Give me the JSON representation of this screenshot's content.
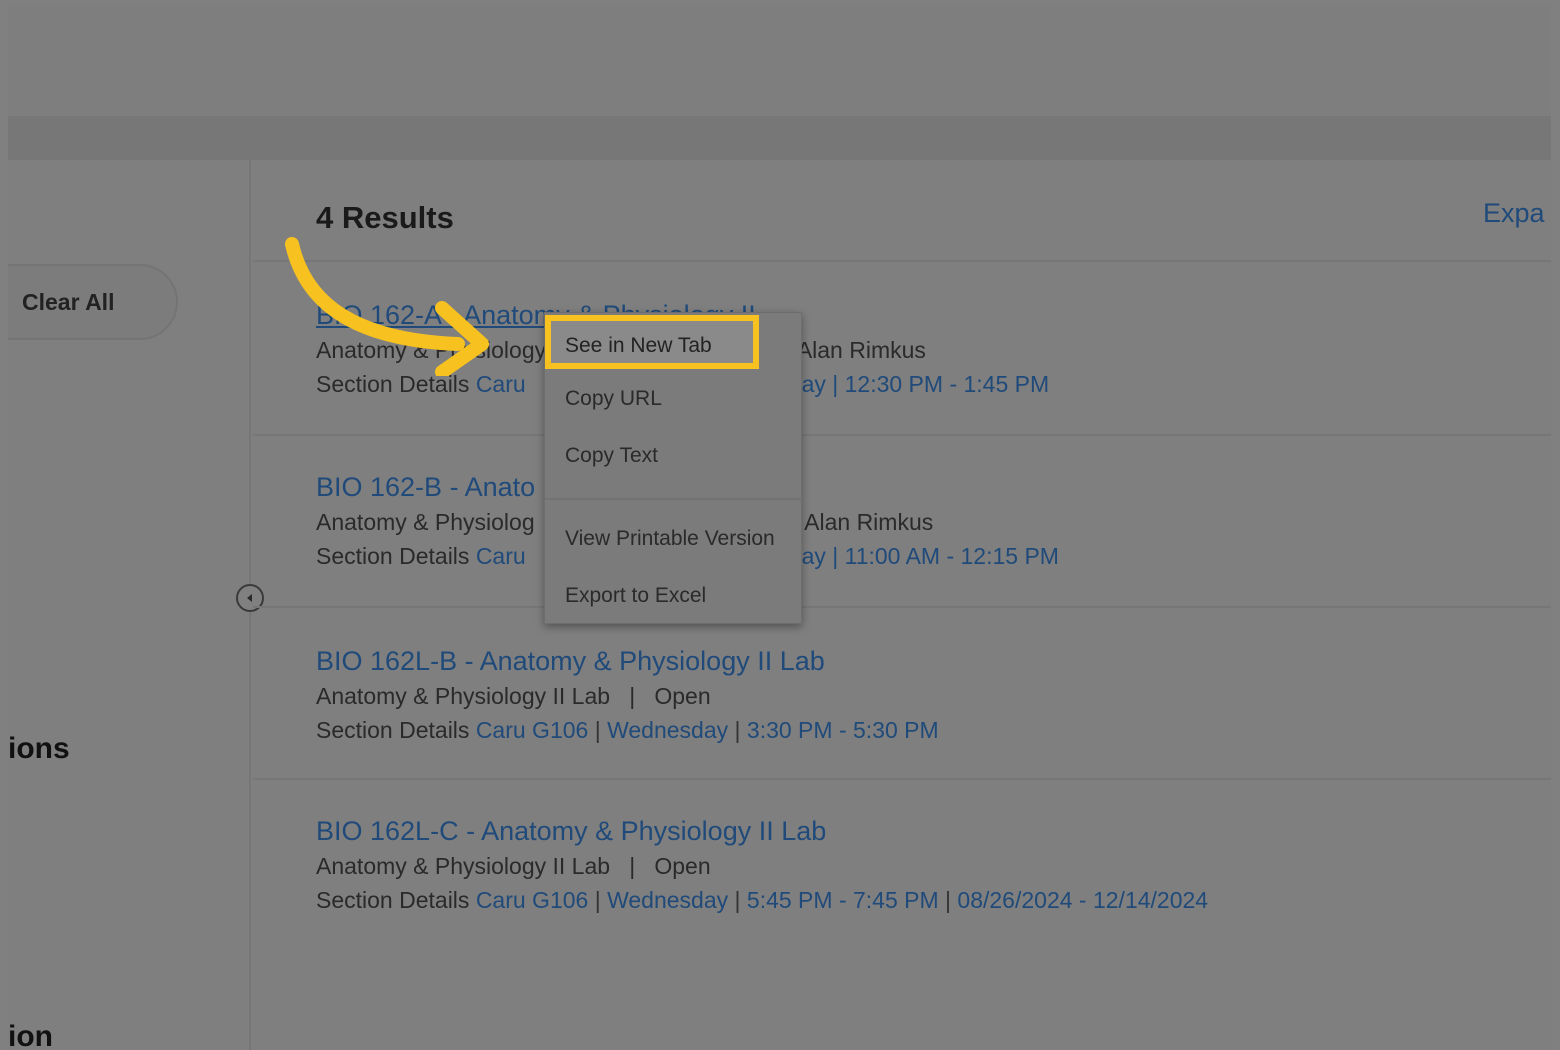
{
  "sidebar": {
    "clear_all_label": "Clear All",
    "heading_1": "ions",
    "heading_2": "ion"
  },
  "results": {
    "count_label": "4 Results",
    "expand_label": "Expa",
    "items": [
      {
        "title": "BIO 162-A - Anatomy & Physiology II",
        "meta": "Anatomy & Physiology II",
        "instructor": "Alan Rimkus",
        "details_prefix": "Section Details",
        "location": "Caru",
        "time": "lay | 12:30 PM - 1:45 PM"
      },
      {
        "title": "BIO 162-B - Anato",
        "meta": "Anatomy & Physiolog",
        "instructor": "Alan Rimkus",
        "details_prefix": "Section Details",
        "location": "Caru",
        "time": "lay | 11:00 AM - 12:15 PM"
      },
      {
        "title": "BIO 162L-B - Anatomy & Physiology II Lab",
        "meta": "Anatomy & Physiology II Lab   |   Open",
        "details_prefix": "Section Details",
        "location": "Caru G106",
        "day": "Wednesday",
        "time": "3:30 PM - 5:30 PM"
      },
      {
        "title": "BIO 162L-C - Anatomy & Physiology II Lab",
        "meta": "Anatomy & Physiology II Lab   |   Open",
        "details_prefix": "Section Details",
        "location": "Caru G106",
        "day": "Wednesday",
        "time": "5:45 PM - 7:45 PM",
        "dates": "08/26/2024 - 12/14/2024"
      }
    ]
  },
  "context_menu": {
    "items": [
      "See in New Tab",
      "Copy URL",
      "Copy Text",
      "View Printable Version",
      "Export to Excel"
    ]
  },
  "colors": {
    "highlight": "#f7c21f",
    "link": "#1f4a7a",
    "overlay": "#808080"
  }
}
